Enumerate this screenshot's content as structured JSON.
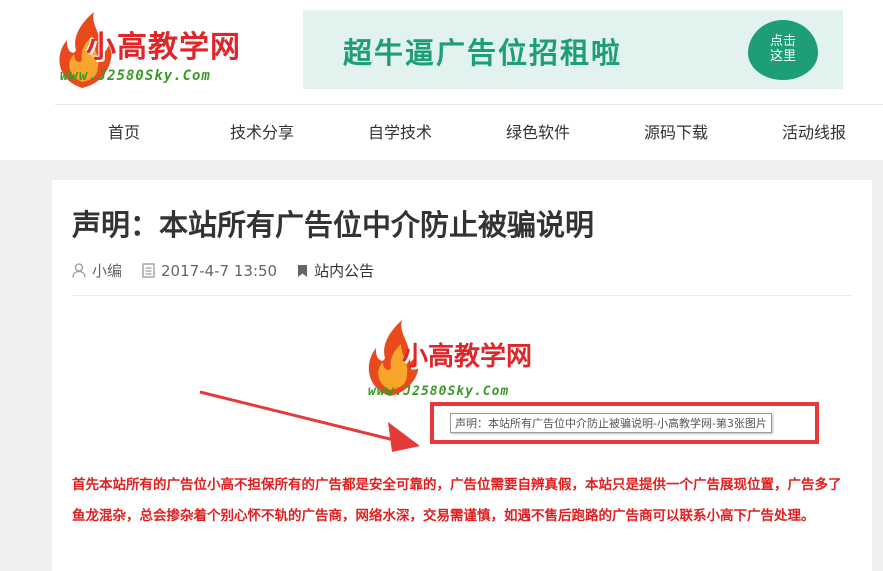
{
  "site": {
    "logo_text": "小高教学网",
    "logo_url_text": "www.J2580Sky.Com"
  },
  "banner": {
    "text": "超牛逼广告位招租啦",
    "bubble_line1": "点击",
    "bubble_line2": "这里"
  },
  "nav": {
    "items": [
      {
        "label": "首页"
      },
      {
        "label": "技术分享"
      },
      {
        "label": "自学技术"
      },
      {
        "label": "绿色软件"
      },
      {
        "label": "源码下载"
      },
      {
        "label": "活动线报"
      }
    ]
  },
  "article": {
    "title": "声明：本站所有广告位中介防止被骗说明",
    "author": "小编",
    "date": "2017-4-7 13:50",
    "category": "站内公告",
    "image_logo_text": "小高教学网",
    "image_url_text": "www.J2580Sky.Com",
    "image_tooltip": "声明：本站所有广告位中介防止被骗说明-小高教学网-第3张图片",
    "body": "首先本站所有的广告位小高不担保所有的广告都是安全可靠的，广告位需要自辨真假，本站只是提供一个广告展现位置，广告多了鱼龙混杂，总会掺杂着个别心怀不轨的广告商，网络水深，交易需谨慎，如遇不售后跑路的广告商可以联系小高下广告处理。"
  },
  "colors": {
    "accent_red": "#e02020",
    "banner_green": "#1d9e77",
    "logo_green": "#3a9a27"
  }
}
